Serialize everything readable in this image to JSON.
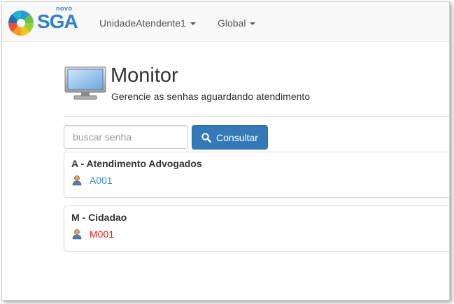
{
  "app": {
    "logo_small": "novo",
    "logo_text": "SGA"
  },
  "nav": {
    "unidade": "UnidadeAtendente1",
    "global": "Global"
  },
  "header": {
    "title": "Monitor",
    "subtitle": "Gerencie as senhas aguardando atendimento"
  },
  "search": {
    "placeholder": "buscar senha",
    "button_label": "Consultar"
  },
  "services": [
    {
      "name": "A - Atendimento Advogados",
      "tickets": [
        {
          "code": "A001",
          "color": "#3a87c8"
        }
      ]
    },
    {
      "name": "M - Cidadao",
      "tickets": [
        {
          "code": "M001",
          "color": "#e02020"
        }
      ]
    }
  ],
  "colors": {
    "primary": "#337ab7",
    "priority": "#e02020",
    "normal": "#3a87c8"
  },
  "icons": [
    "logo-icon",
    "caret-down-icon",
    "monitor-icon",
    "search-icon",
    "user-icon"
  ]
}
